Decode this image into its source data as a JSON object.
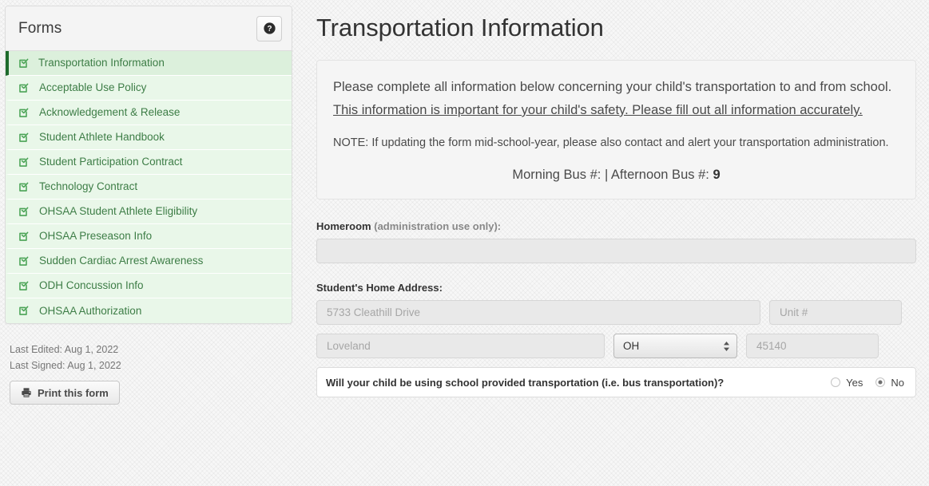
{
  "sidebar": {
    "panel_title": "Forms",
    "help_icon": "question-circle-icon",
    "items": [
      {
        "label": "Transportation Information",
        "icon": "check-square-icon",
        "active": true
      },
      {
        "label": "Acceptable Use Policy",
        "icon": "check-square-icon",
        "active": false
      },
      {
        "label": "Acknowledgement & Release",
        "icon": "check-square-icon",
        "active": false
      },
      {
        "label": "Student Athlete Handbook",
        "icon": "check-square-icon",
        "active": false
      },
      {
        "label": "Student Participation Contract",
        "icon": "check-square-icon",
        "active": false
      },
      {
        "label": "Technology Contract",
        "icon": "check-square-icon",
        "active": false
      },
      {
        "label": "OHSAA Student Athlete Eligibility",
        "icon": "check-square-icon",
        "active": false
      },
      {
        "label": "OHSAA Preseason Info",
        "icon": "check-square-icon",
        "active": false
      },
      {
        "label": "Sudden Cardiac Arrest Awareness",
        "icon": "check-square-icon",
        "active": false
      },
      {
        "label": "ODH Concussion Info",
        "icon": "check-square-icon",
        "active": false
      },
      {
        "label": "OHSAA Authorization",
        "icon": "check-square-icon",
        "active": false
      }
    ],
    "last_edited": "Last Edited: Aug 1, 2022",
    "last_signed": "Last Signed: Aug 1, 2022",
    "print_label": "Print this form",
    "print_icon": "printer-icon"
  },
  "main": {
    "title": "Transportation Information",
    "info": {
      "paragraph_lead": "Please complete all information below concerning your child's transportation to and from school. ",
      "paragraph_emphasis": "This information is important for your child's safety. Please fill out all information accurately.",
      "note": "NOTE: If updating the form mid-school-year, please also contact and alert your transportation administration.",
      "bus_morning_label": "Morning Bus #:",
      "bus_separator": "|",
      "bus_afternoon_label": "Afternoon Bus #:",
      "bus_morning_value": "",
      "bus_afternoon_value": "9"
    },
    "homeroom": {
      "label_strong": "Homeroom",
      "label_muted": " (administration use only):",
      "value": "",
      "placeholder": ""
    },
    "address": {
      "label": "Student's Home Address:",
      "street_placeholder": "5733 Cleathill Drive",
      "street_value": "",
      "unit_placeholder": "Unit #",
      "unit_value": "",
      "city_placeholder": "Loveland",
      "city_value": "",
      "state_value": "OH",
      "state_options": [
        "OH"
      ],
      "zip_placeholder": "45140",
      "zip_value": ""
    },
    "question": {
      "text": "Will your child be using school provided transportation (i.e. bus transportation)?",
      "options": [
        {
          "label": "Yes",
          "checked": false
        },
        {
          "label": "No",
          "checked": true
        }
      ]
    }
  },
  "colors": {
    "accent_green": "#1d6b2b",
    "item_green_bg": "#e9f7e9",
    "item_green_text": "#3d7d46",
    "page_bg": "#f7f7f7"
  }
}
